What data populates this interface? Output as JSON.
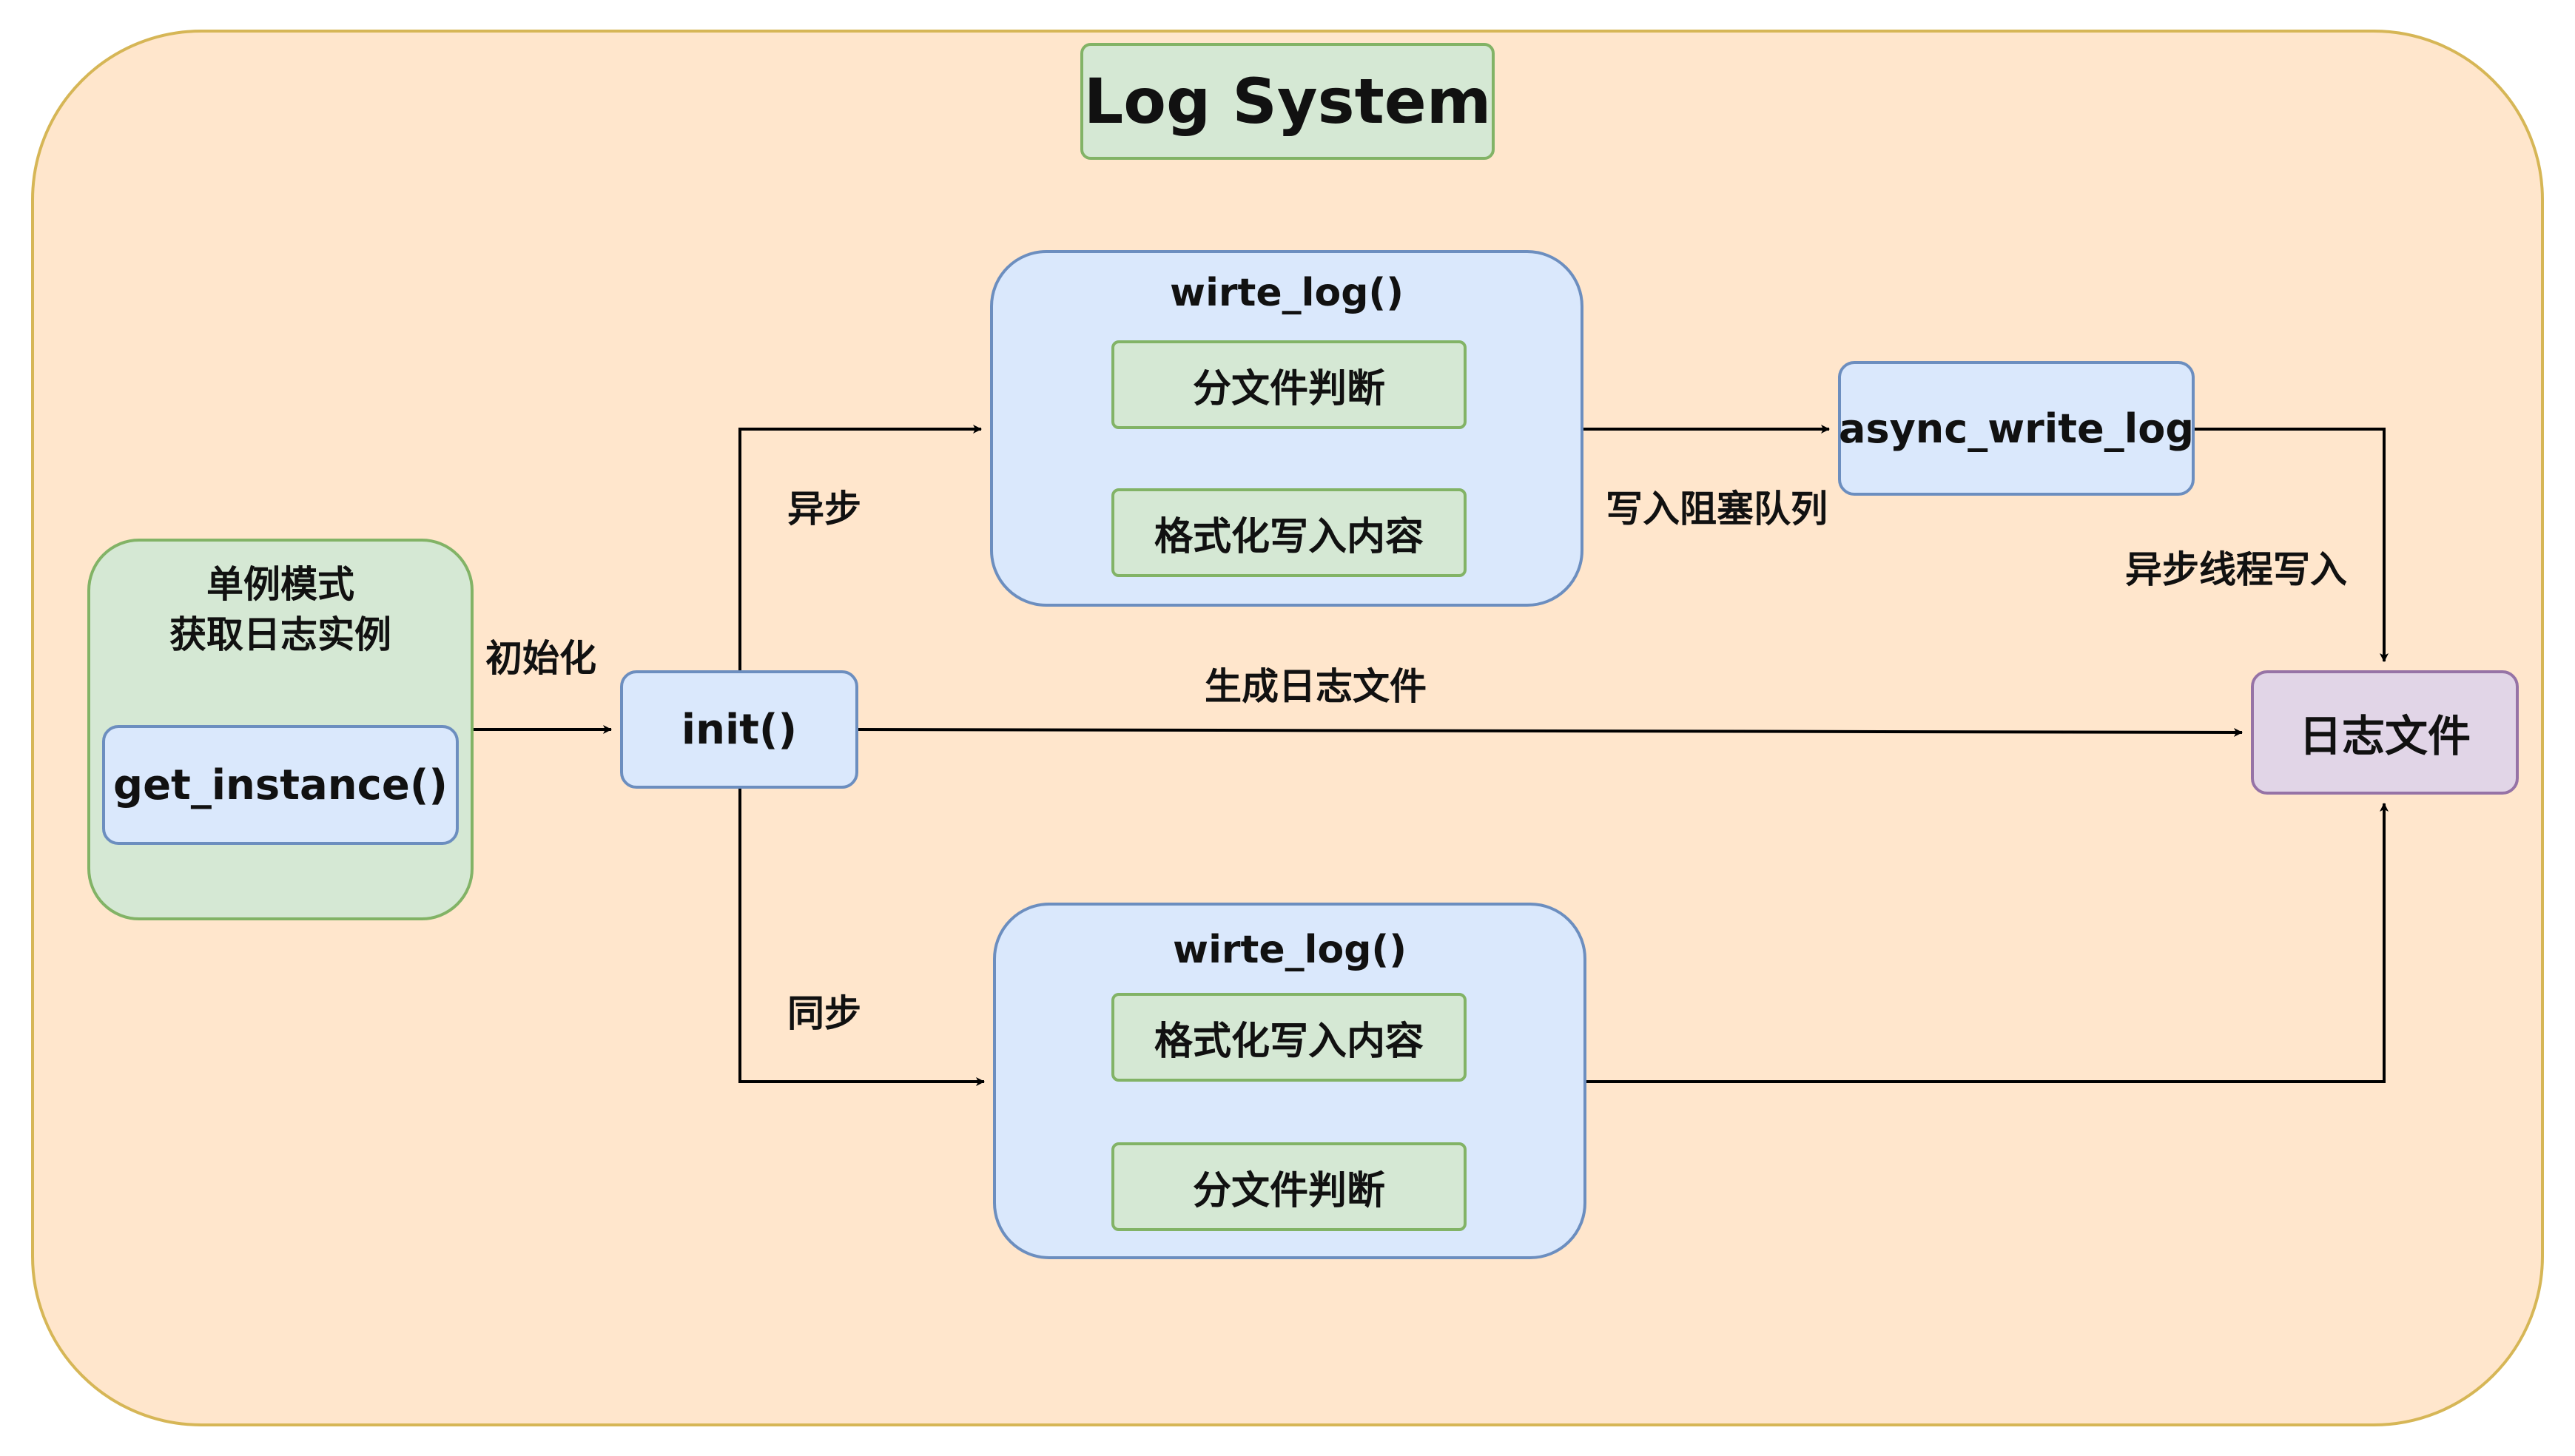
{
  "title": "Log System",
  "singleton": {
    "caption_line1": "单例模式",
    "caption_line2": "获取日志实例",
    "method": "get_instance()"
  },
  "init": {
    "label": "init()"
  },
  "async_branch": {
    "label": "异步",
    "box_title": "wirte_log()",
    "step1": "分文件判断",
    "step2": "格式化写入内容"
  },
  "sync_branch": {
    "label": "同步",
    "box_title": "wirte_log()",
    "step1": "格式化写入内容",
    "step2": "分文件判断"
  },
  "async_writer": {
    "label": "async_write_log"
  },
  "log_file": {
    "label": "日志文件"
  },
  "edge_labels": {
    "initialize": "初始化",
    "create_file": "生成日志文件",
    "write_queue": "写入阻塞队列",
    "async_thread_write": "异步线程写入"
  },
  "colors": {
    "background": "#ffe6cc",
    "background_border": "#d6b656",
    "green_fill": "#d5e8d4",
    "green_border": "#82b366",
    "blue_fill": "#dae8fc",
    "blue_border": "#6c8ebf",
    "purple_fill": "#e1d5e7",
    "purple_border": "#9673a6"
  }
}
